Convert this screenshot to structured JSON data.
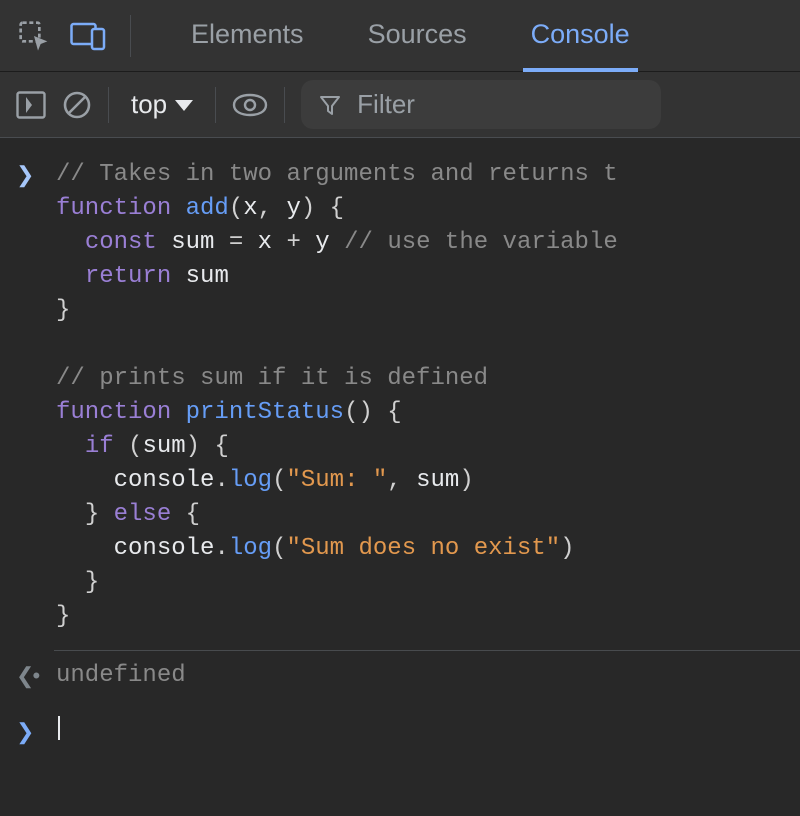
{
  "topbar": {
    "tabs": [
      {
        "label": "Elements",
        "active": false
      },
      {
        "label": "Sources",
        "active": false
      },
      {
        "label": "Console",
        "active": true
      }
    ]
  },
  "toolbar": {
    "context_label": "top",
    "filter_placeholder": "Filter"
  },
  "console": {
    "input_code": {
      "lines": [
        {
          "indent": 0,
          "tokens": [
            {
              "t": "com",
              "v": "// Takes in two arguments and returns t"
            }
          ]
        },
        {
          "indent": 0,
          "tokens": [
            {
              "t": "kw",
              "v": "function"
            },
            {
              "t": "sp"
            },
            {
              "t": "fn",
              "v": "add"
            },
            {
              "t": "punc",
              "v": "("
            },
            {
              "t": "id",
              "v": "x"
            },
            {
              "t": "punc",
              "v": ", "
            },
            {
              "t": "id",
              "v": "y"
            },
            {
              "t": "punc",
              "v": ") {"
            }
          ]
        },
        {
          "indent": 1,
          "tokens": [
            {
              "t": "kw",
              "v": "const"
            },
            {
              "t": "sp"
            },
            {
              "t": "id",
              "v": "sum"
            },
            {
              "t": "sp"
            },
            {
              "t": "punc",
              "v": "="
            },
            {
              "t": "sp"
            },
            {
              "t": "id",
              "v": "x"
            },
            {
              "t": "sp"
            },
            {
              "t": "punc",
              "v": "+"
            },
            {
              "t": "sp"
            },
            {
              "t": "id",
              "v": "y"
            },
            {
              "t": "sp"
            },
            {
              "t": "com",
              "v": "// use the variable"
            }
          ]
        },
        {
          "indent": 1,
          "tokens": [
            {
              "t": "kw",
              "v": "return"
            },
            {
              "t": "sp"
            },
            {
              "t": "id",
              "v": "sum"
            }
          ]
        },
        {
          "indent": 0,
          "tokens": [
            {
              "t": "punc",
              "v": "}"
            }
          ]
        },
        {
          "indent": 0,
          "tokens": []
        },
        {
          "indent": 0,
          "tokens": [
            {
              "t": "com",
              "v": "// prints sum if it is defined"
            }
          ]
        },
        {
          "indent": 0,
          "tokens": [
            {
              "t": "kw",
              "v": "function"
            },
            {
              "t": "sp"
            },
            {
              "t": "fn",
              "v": "printStatus"
            },
            {
              "t": "punc",
              "v": "() {"
            }
          ]
        },
        {
          "indent": 1,
          "tokens": [
            {
              "t": "kw",
              "v": "if"
            },
            {
              "t": "sp"
            },
            {
              "t": "punc",
              "v": "("
            },
            {
              "t": "id",
              "v": "sum"
            },
            {
              "t": "punc",
              "v": ") {"
            }
          ]
        },
        {
          "indent": 2,
          "tokens": [
            {
              "t": "id",
              "v": "console"
            },
            {
              "t": "punc",
              "v": "."
            },
            {
              "t": "fn",
              "v": "log"
            },
            {
              "t": "punc",
              "v": "("
            },
            {
              "t": "str",
              "v": "\"Sum: \""
            },
            {
              "t": "punc",
              "v": ", "
            },
            {
              "t": "id",
              "v": "sum"
            },
            {
              "t": "punc",
              "v": ")"
            }
          ]
        },
        {
          "indent": 1,
          "tokens": [
            {
              "t": "punc",
              "v": "}"
            },
            {
              "t": "sp"
            },
            {
              "t": "kw",
              "v": "else"
            },
            {
              "t": "sp"
            },
            {
              "t": "punc",
              "v": "{"
            }
          ]
        },
        {
          "indent": 2,
          "tokens": [
            {
              "t": "id",
              "v": "console"
            },
            {
              "t": "punc",
              "v": "."
            },
            {
              "t": "fn",
              "v": "log"
            },
            {
              "t": "punc",
              "v": "("
            },
            {
              "t": "str",
              "v": "\"Sum does no exist\""
            },
            {
              "t": "punc",
              "v": ")"
            }
          ]
        },
        {
          "indent": 1,
          "tokens": [
            {
              "t": "punc",
              "v": "}"
            }
          ]
        },
        {
          "indent": 0,
          "tokens": [
            {
              "t": "punc",
              "v": "}"
            }
          ]
        }
      ]
    },
    "output_text": "undefined"
  }
}
